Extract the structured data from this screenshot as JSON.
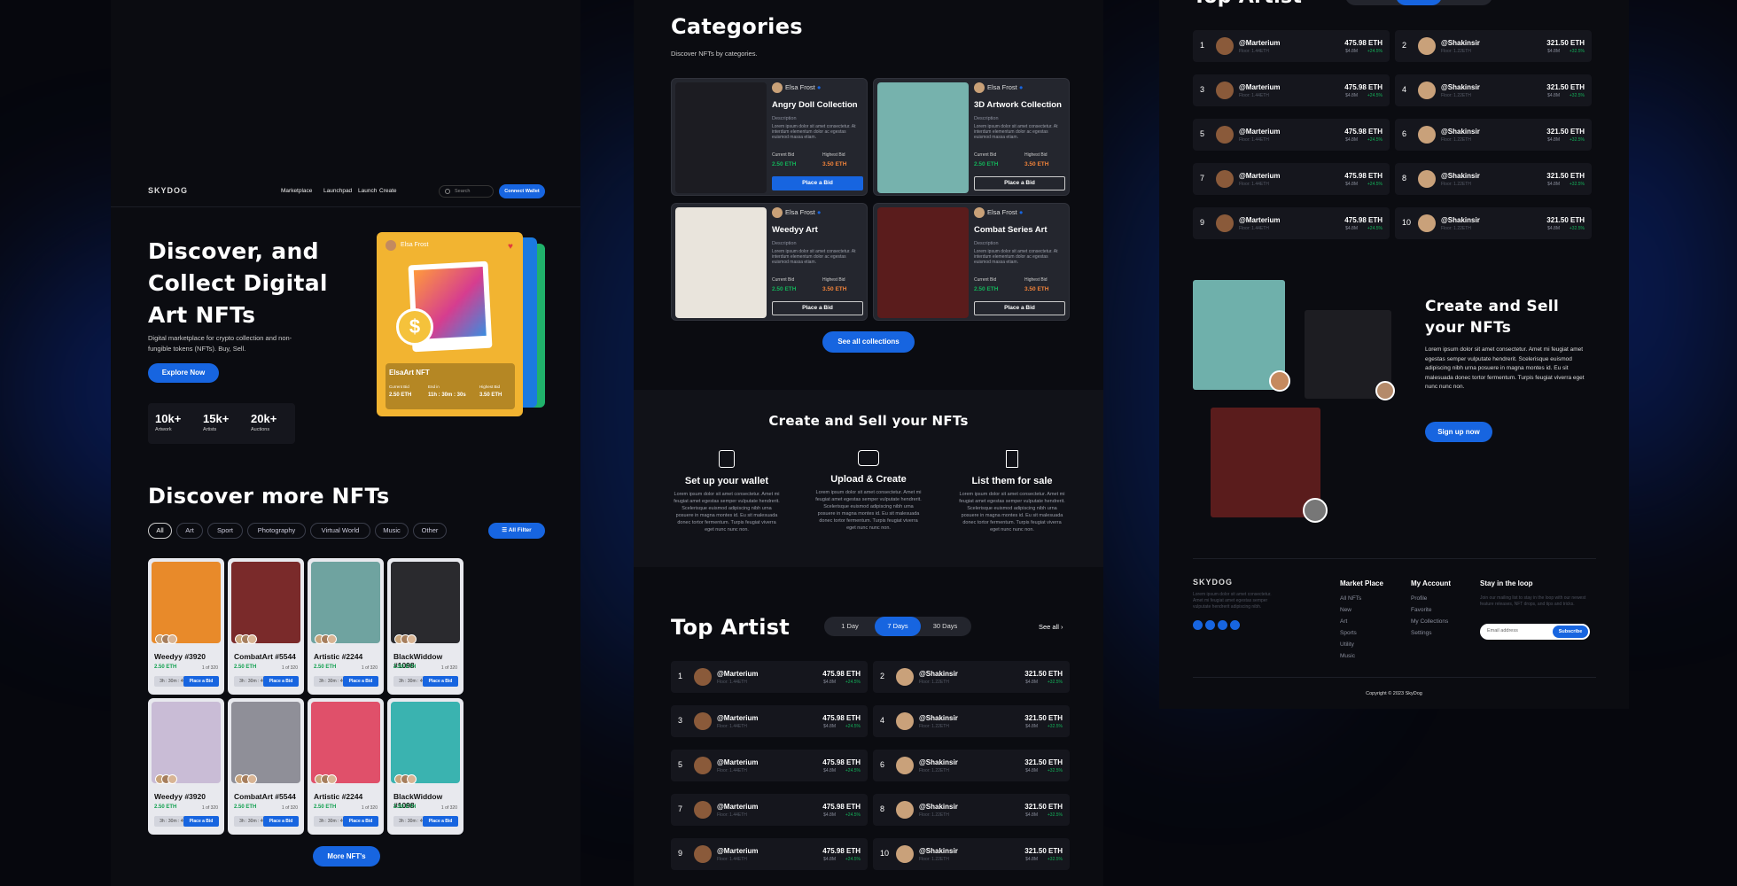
{
  "header": {
    "logo": "SKYDOG",
    "nav": [
      "Marketplace",
      "Launchpad",
      "Launch",
      "Create"
    ],
    "search_placeholder": "Search",
    "connect": "Connect Wallet"
  },
  "hero": {
    "title_l1": "Discover, and",
    "title_l2": "Collect Digital",
    "title_l3": "Art NFTs",
    "sub": "Digital marketplace for crypto collection and non-fungible tokens (NFTs). Buy, Sell.",
    "cta": "Explore Now",
    "stats": [
      {
        "v": "10k+",
        "l": "Artwork"
      },
      {
        "v": "15k+",
        "l": "Artists"
      },
      {
        "v": "20k+",
        "l": "Auctions"
      }
    ],
    "card": {
      "author": "Elsa Frost",
      "name": "ElsaArt NFT",
      "l1": "Current Bid",
      "v1": "2.50 ETH",
      "l2": "End in",
      "v2": "11h : 30m : 30s",
      "l3": "Highest Bid",
      "v3": "3.50 ETH"
    }
  },
  "discover": {
    "title": "Discover more NFTs",
    "filters": [
      "All",
      "Art",
      "Sport",
      "Photography",
      "Virtual World",
      "Music",
      "Other"
    ],
    "all_filter": "All Filter",
    "more": "More NFT's",
    "cards": [
      {
        "name": "Weedyy #3920",
        "price": "2.50 ETH",
        "of": "1 of 320",
        "time": "3h : 30m : 40s",
        "bid": "Place a Bid",
        "bg": "#e88a2a"
      },
      {
        "name": "CombatArt #5544",
        "price": "2.50 ETH",
        "of": "1 of 320",
        "time": "3h : 30m : 40s",
        "bid": "Place a Bid",
        "bg": "#7a2a2a"
      },
      {
        "name": "Artistic #2244",
        "price": "2.50 ETH",
        "of": "1 of 320",
        "time": "3h : 30m : 40s",
        "bid": "Place a Bid",
        "bg": "#6fa3a0"
      },
      {
        "name": "BlackWiddow #1098",
        "price": "2.50 ETH",
        "of": "1 of 320",
        "time": "3h : 30m : 40s",
        "bid": "Place a Bid",
        "bg": "#2a2a2e"
      },
      {
        "name": "Weedyy #3920",
        "price": "2.50 ETH",
        "of": "1 of 320",
        "time": "3h : 30m : 40s",
        "bid": "Place a Bid",
        "bg": "#c9bcd6"
      },
      {
        "name": "CombatArt #5544",
        "price": "2.50 ETH",
        "of": "1 of 320",
        "time": "3h : 30m : 40s",
        "bid": "Place a Bid",
        "bg": "#8f8f98"
      },
      {
        "name": "Artistic #2244",
        "price": "2.50 ETH",
        "of": "1 of 320",
        "time": "3h : 30m : 40s",
        "bid": "Place a Bid",
        "bg": "#e0506a"
      },
      {
        "name": "BlackWiddow #1098",
        "price": "2.50 ETH",
        "of": "1 of 320",
        "time": "3h : 30m : 40s",
        "bid": "Place a Bid",
        "bg": "#3ab3b0"
      }
    ]
  },
  "categories": {
    "title": "Categories",
    "sub": "Discover NFTs by categories.",
    "see_all": "See all collections",
    "items": [
      {
        "author": "Elsa Frost",
        "title": "Angry Doll Collection",
        "desc_label": "Description",
        "desc": "Lorem ipsum dolor sit amet consectetur. At interdum elementum dolor ac egestas euismod massa etiam.",
        "l1": "Current Bid",
        "v1": "2.50 ETH",
        "l2": "Highest Bid",
        "v2": "3.50 ETH",
        "btn": "Place a Bid",
        "bg": "#1c1c22"
      },
      {
        "author": "Elsa Frost",
        "title": "3D Artwork Collection",
        "desc_label": "Description",
        "desc": "Lorem ipsum dolor sit amet consectetur. At interdum elementum dolor ac egestas euismod massa etiam.",
        "l1": "Current Bid",
        "v1": "2.50 ETH",
        "l2": "Highest Bid",
        "v2": "3.50 ETH",
        "btn": "Place a Bid",
        "bg": "#76b2ad"
      },
      {
        "author": "Elsa Frost",
        "title": "Weedyy Art",
        "desc_label": "Description",
        "desc": "Lorem ipsum dolor sit amet consectetur. At interdum elementum dolor ac egestas euismod massa etiam.",
        "l1": "Current Bid",
        "v1": "2.50 ETH",
        "l2": "Highest Bid",
        "v2": "3.50 ETH",
        "btn": "Place a Bid",
        "bg": "#e9e4dc"
      },
      {
        "author": "Elsa Frost",
        "title": "Combat Series Art",
        "desc_label": "Description",
        "desc": "Lorem ipsum dolor sit amet consectetur. At interdum elementum dolor ac egestas euismod massa etiam.",
        "l1": "Current Bid",
        "v1": "2.50 ETH",
        "l2": "Highest Bid",
        "v2": "3.50 ETH",
        "btn": "Place a Bid",
        "bg": "#5a1c1c"
      }
    ]
  },
  "create": {
    "title": "Create and Sell your NFTs",
    "steps": [
      {
        "t": "Set up your wallet",
        "d": "Lorem ipsum dolor sit amet consectetur. Amet mi feugiat amet egestas semper vulputate hendrerit. Scelerisque euismod adipiscing nibh urna posuere in magna montes id. Eu sit malesuada donec tortor fermentum. Turpis feugiat viverra eget nunc nunc non."
      },
      {
        "t": "Upload & Create",
        "d": "Lorem ipsum dolor sit amet consectetur. Amet mi feugiat amet egestas semper vulputate hendrerit. Scelerisque euismod adipiscing nibh urna posuere in magna montes id. Eu sit malesuada donec tortor fermentum. Turpis feugiat viverra eget nunc nunc non."
      },
      {
        "t": "List them for sale",
        "d": "Lorem ipsum dolor sit amet consectetur. Amet mi feugiat amet egestas semper vulputate hendrerit. Scelerisque euismod adipiscing nibh urna posuere in magna montes id. Eu sit malesuada donec tortor fermentum. Turpis feugiat viverra eget nunc nunc non."
      }
    ]
  },
  "top": {
    "title": "Top Artist",
    "tabs": [
      "1 Day",
      "7 Days",
      "30 Days"
    ],
    "see_all": "See all",
    "left": [
      {
        "n": "1",
        "h": "@Marterium",
        "f": "Floor: 1.44ETH",
        "e": "475.98 ETH",
        "v": "$4.8M",
        "p": "+24.5%"
      },
      {
        "n": "3",
        "h": "@Marterium",
        "f": "Floor: 1.44ETH",
        "e": "475.98 ETH",
        "v": "$4.8M",
        "p": "+24.5%"
      },
      {
        "n": "5",
        "h": "@Marterium",
        "f": "Floor: 1.44ETH",
        "e": "475.98 ETH",
        "v": "$4.8M",
        "p": "+24.5%"
      },
      {
        "n": "7",
        "h": "@Marterium",
        "f": "Floor: 1.44ETH",
        "e": "475.98 ETH",
        "v": "$4.8M",
        "p": "+24.5%"
      },
      {
        "n": "9",
        "h": "@Marterium",
        "f": "Floor: 1.44ETH",
        "e": "475.98 ETH",
        "v": "$4.8M",
        "p": "+24.5%"
      }
    ],
    "right": [
      {
        "n": "2",
        "h": "@Shakinsir",
        "f": "Floor: 1.22ETH",
        "e": "321.50 ETH",
        "v": "$4.8M",
        "p": "+32.5%"
      },
      {
        "n": "4",
        "h": "@Shakinsir",
        "f": "Floor: 1.22ETH",
        "e": "321.50 ETH",
        "v": "$4.8M",
        "p": "+32.5%"
      },
      {
        "n": "6",
        "h": "@Shakinsir",
        "f": "Floor: 1.22ETH",
        "e": "321.50 ETH",
        "v": "$4.8M",
        "p": "+32.5%"
      },
      {
        "n": "8",
        "h": "@Shakinsir",
        "f": "Floor: 1.22ETH",
        "e": "321.50 ETH",
        "v": "$4.8M",
        "p": "+32.5%"
      },
      {
        "n": "10",
        "h": "@Shakinsir",
        "f": "Floor: 1.22ETH",
        "e": "321.50 ETH",
        "v": "$4.8M",
        "p": "+32.5%"
      }
    ]
  },
  "sell": {
    "title_l1": "Create and Sell",
    "title_l2": "your NFTs",
    "text": "Lorem ipsum dolor sit amet consectetur. Amet mi feugiat amet egestas semper vulputate hendrerit. Scelerisque euismod adipiscing nibh urna posuere in magna montes id. Eu sit malesuada donec tortor fermentum. Turpis feugiat viverra eget nunc nunc non.",
    "cta": "Sign up now"
  },
  "footer": {
    "logo": "SKYDOG",
    "blurb": "Lorem ipsum dolor sit amet consectetur. Amet mi feugiat amet egestas semper vulputate hendrerit adipiscing nibh.",
    "market_head": "Market Place",
    "market": [
      "All NFTs",
      "New",
      "Art",
      "Sports",
      "Utility",
      "Music"
    ],
    "account_head": "My Account",
    "account": [
      "Profile",
      "Favorite",
      "My Collections",
      "Settings"
    ],
    "loop_head": "Stay in the loop",
    "loop_text": "Join our mailing list to stay in the loop with our newest feature releases, NFT drops, and tips and tricks.",
    "email_placeholder": "Email address",
    "subscribe": "Subscribe",
    "copyright": "Copyright © 2023 SkyDog"
  },
  "colors": {
    "accent": "#1765e0",
    "green": "#13b35a",
    "orange": "#f0823a"
  }
}
